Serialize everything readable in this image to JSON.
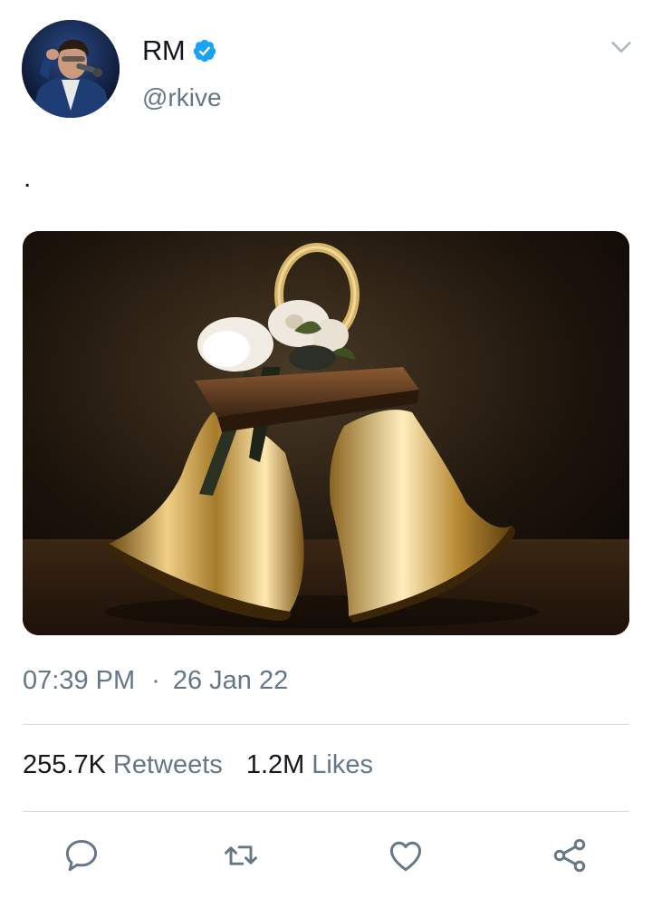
{
  "tweet": {
    "author": {
      "name": "RM",
      "handle": "@rkive",
      "verified": true,
      "avatar_icon": "avatar-photo"
    },
    "text": ".",
    "media": {
      "kind": "photo",
      "subject": "golden-bells-photo"
    },
    "time": "07:39 PM",
    "separator": "·",
    "date": "26 Jan 22",
    "stats": {
      "retweets_count": "255.7K",
      "retweets_label": "Retweets",
      "likes_count": "1.2M",
      "likes_label": "Likes"
    },
    "actions": [
      "reply-icon",
      "retweet-icon",
      "like-icon",
      "share-icon"
    ]
  },
  "colors": {
    "text_primary": "#14171a",
    "text_secondary": "#657786",
    "verified_blue": "#1da1f2",
    "divider": "#d6dce1"
  }
}
